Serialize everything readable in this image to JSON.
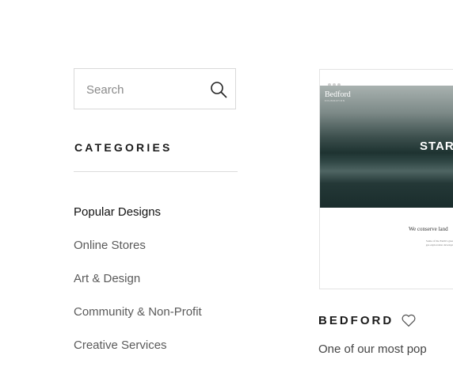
{
  "search": {
    "placeholder": "Search"
  },
  "categories": {
    "heading": "CATEGORIES",
    "items": [
      {
        "label": "Popular Designs"
      },
      {
        "label": "Online Stores"
      },
      {
        "label": "Art & Design"
      },
      {
        "label": "Community & Non-Profit"
      },
      {
        "label": "Creative Services"
      }
    ]
  },
  "template": {
    "preview": {
      "brand": "Bedford",
      "brand_sub": "FOUNDATION",
      "headline": "STAR",
      "tagline": "We conserve land",
      "fine_print": "Some of the Earth's great and gas exploration development, but"
    },
    "title": "BEDFORD",
    "description": "One of our most pop"
  }
}
